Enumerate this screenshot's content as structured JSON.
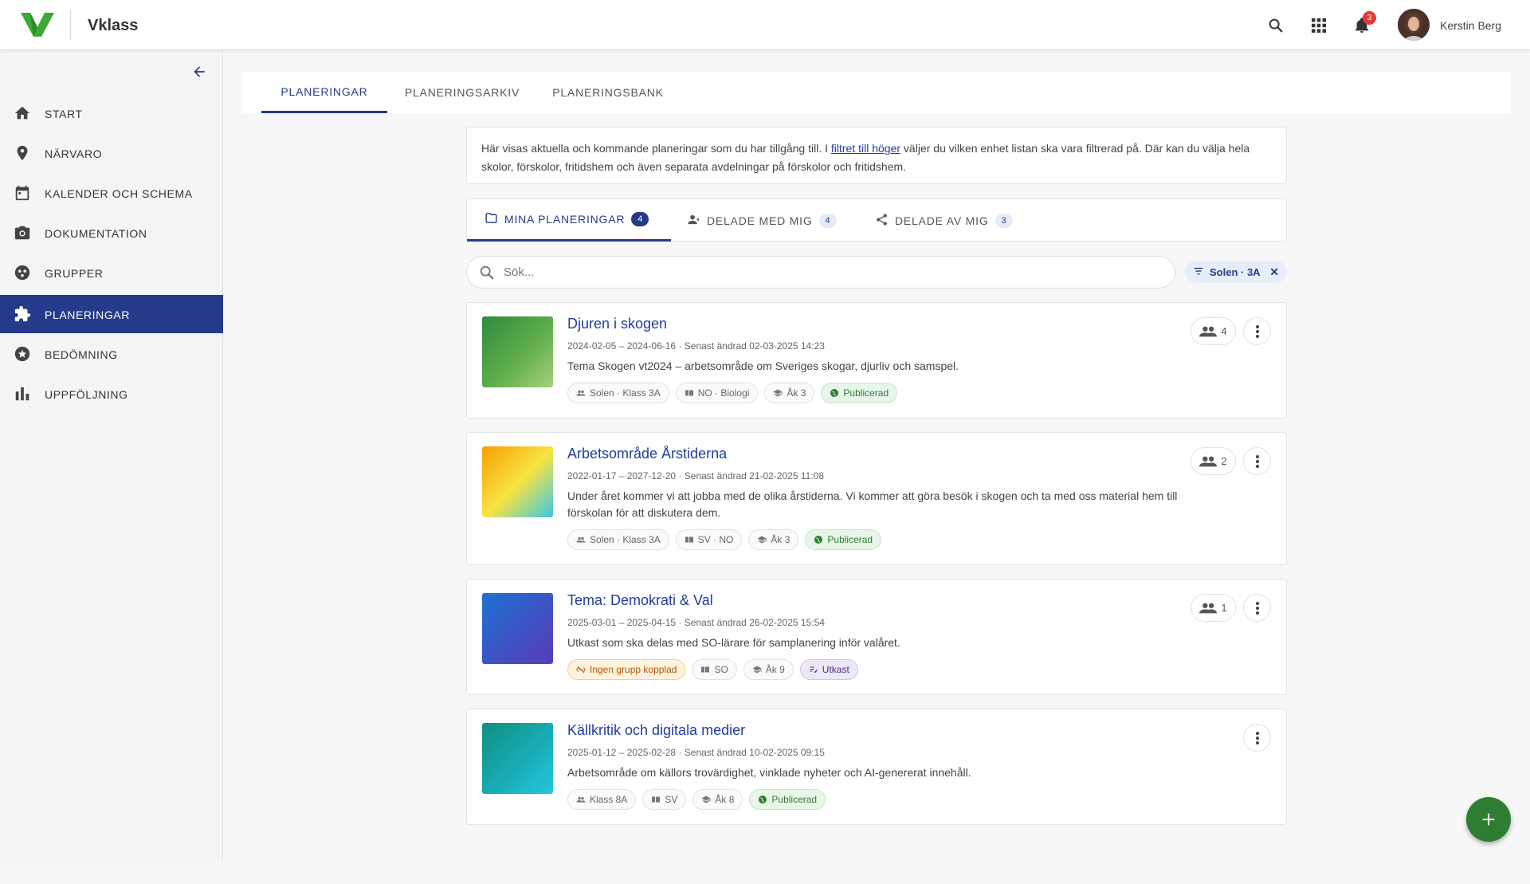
{
  "header": {
    "app_name": "Vklass",
    "notification_count": "3",
    "user_name": "Kerstin Berg"
  },
  "sidebar": {
    "items": [
      {
        "label": "START",
        "icon": "home-icon"
      },
      {
        "label": "NÄRVARO",
        "icon": "location-pin-icon"
      },
      {
        "label": "KALENDER OCH SCHEMA",
        "icon": "calendar-icon"
      },
      {
        "label": "DOKUMENTATION",
        "icon": "camera-icon"
      },
      {
        "label": "GRUPPER",
        "icon": "groups-icon"
      },
      {
        "label": "PLANERINGAR",
        "icon": "puzzle-icon",
        "active": true
      },
      {
        "label": "BEDÖMNING",
        "icon": "star-badge-icon"
      },
      {
        "label": "UPPFÖLJNING",
        "icon": "bar-chart-icon"
      }
    ]
  },
  "top_tabs": [
    "PLANERINGAR",
    "PLANERINGSARKIV",
    "PLANERINGSBANK"
  ],
  "info": {
    "text_before": "Här visas aktuella och kommande planeringar som du har tillgång till. I ",
    "link": "filtret till höger",
    "text_after": " väljer du vilken enhet listan ska vara filtrerad på. Där kan du välja hela skolor, förskolor, fritidshem och även separata avdelningar på förskolor och fritidshem."
  },
  "sub_tabs": [
    {
      "label": "MINA PLANERINGAR",
      "count": "4",
      "icon": "folder-icon"
    },
    {
      "label": "DELADE MED MIG",
      "count": "4",
      "icon": "person-shared-icon"
    },
    {
      "label": "DELADE AV MIG",
      "count": "3",
      "icon": "share-icon"
    }
  ],
  "search": {
    "placeholder": "Sök..."
  },
  "filter": {
    "label": "Solen · 3A"
  },
  "cards": [
    {
      "title": "Djuren i skogen",
      "meta": "2024-02-05 – 2024-06-16 · Senast ändrad 02-03-2025 14:23",
      "desc": "Tema Skogen vt2024 – arbetsområde om Sveriges skogar, djurliv och samspel.",
      "members": "4",
      "tags": [
        {
          "text": "Solen · Klass 3A",
          "kind": "group"
        },
        {
          "text": "NO · Biologi",
          "kind": "subject"
        },
        {
          "text": "Åk 3",
          "kind": "grade"
        },
        {
          "text": "Publicerad",
          "kind": "published"
        }
      ],
      "colors": [
        "#2e8b3d",
        "#8cc66d"
      ]
    },
    {
      "title": "Arbetsområde Årstiderna",
      "meta": "2022-01-17 – 2027-12-20 · Senast ändrad 21-02-2025 11:08",
      "desc": "Under året kommer vi att jobba med de olika årstiderna. Vi kommer att göra besök i skogen och ta med oss material hem till förskolan för att diskutera dem.",
      "members": "2",
      "tags": [
        {
          "text": "Solen · Klass 3A",
          "kind": "group"
        },
        {
          "text": "SV · NO",
          "kind": "subject"
        },
        {
          "text": "Åk 3",
          "kind": "grade"
        },
        {
          "text": "Publicerad",
          "kind": "published"
        }
      ],
      "colors": [
        "#f5a623",
        "#f7e44a",
        "#3cc6e8"
      ]
    },
    {
      "title": "Tema: Demokrati & Val",
      "meta": "2025-03-01 – 2025-04-15 · Senast ändrad 26-02-2025 15:54",
      "desc": "Utkast som ska delas med SO-lärare för samplanering inför valåret.",
      "members": "1",
      "tags": [
        {
          "text": "Ingen grupp kopplad",
          "kind": "warning"
        },
        {
          "text": "SO",
          "kind": "subject"
        },
        {
          "text": "Åk 9",
          "kind": "grade"
        },
        {
          "text": "Utkast",
          "kind": "draft"
        }
      ],
      "colors": [
        "#1e6fd0",
        "#5a3ab8"
      ]
    },
    {
      "title": "Källkritik och digitala medier",
      "meta": "2025-01-12 – 2025-02-28 · Senast ändrad 10-02-2025 09:15",
      "desc": "Arbetsområde om källors trovärdighet, vinklade nyheter och AI-genererat innehåll.",
      "members": "",
      "tags": [
        {
          "text": "Klass 8A",
          "kind": "group"
        },
        {
          "text": "SV",
          "kind": "subject"
        },
        {
          "text": "Åk 8",
          "kind": "grade"
        },
        {
          "text": "Publicerad",
          "kind": "published"
        }
      ],
      "colors": [
        "#12988a",
        "#22c3e0"
      ]
    }
  ],
  "colors": {
    "brand": "#253b8a",
    "accent_green": "#2e7d32",
    "logo_green": "#3aa935"
  }
}
